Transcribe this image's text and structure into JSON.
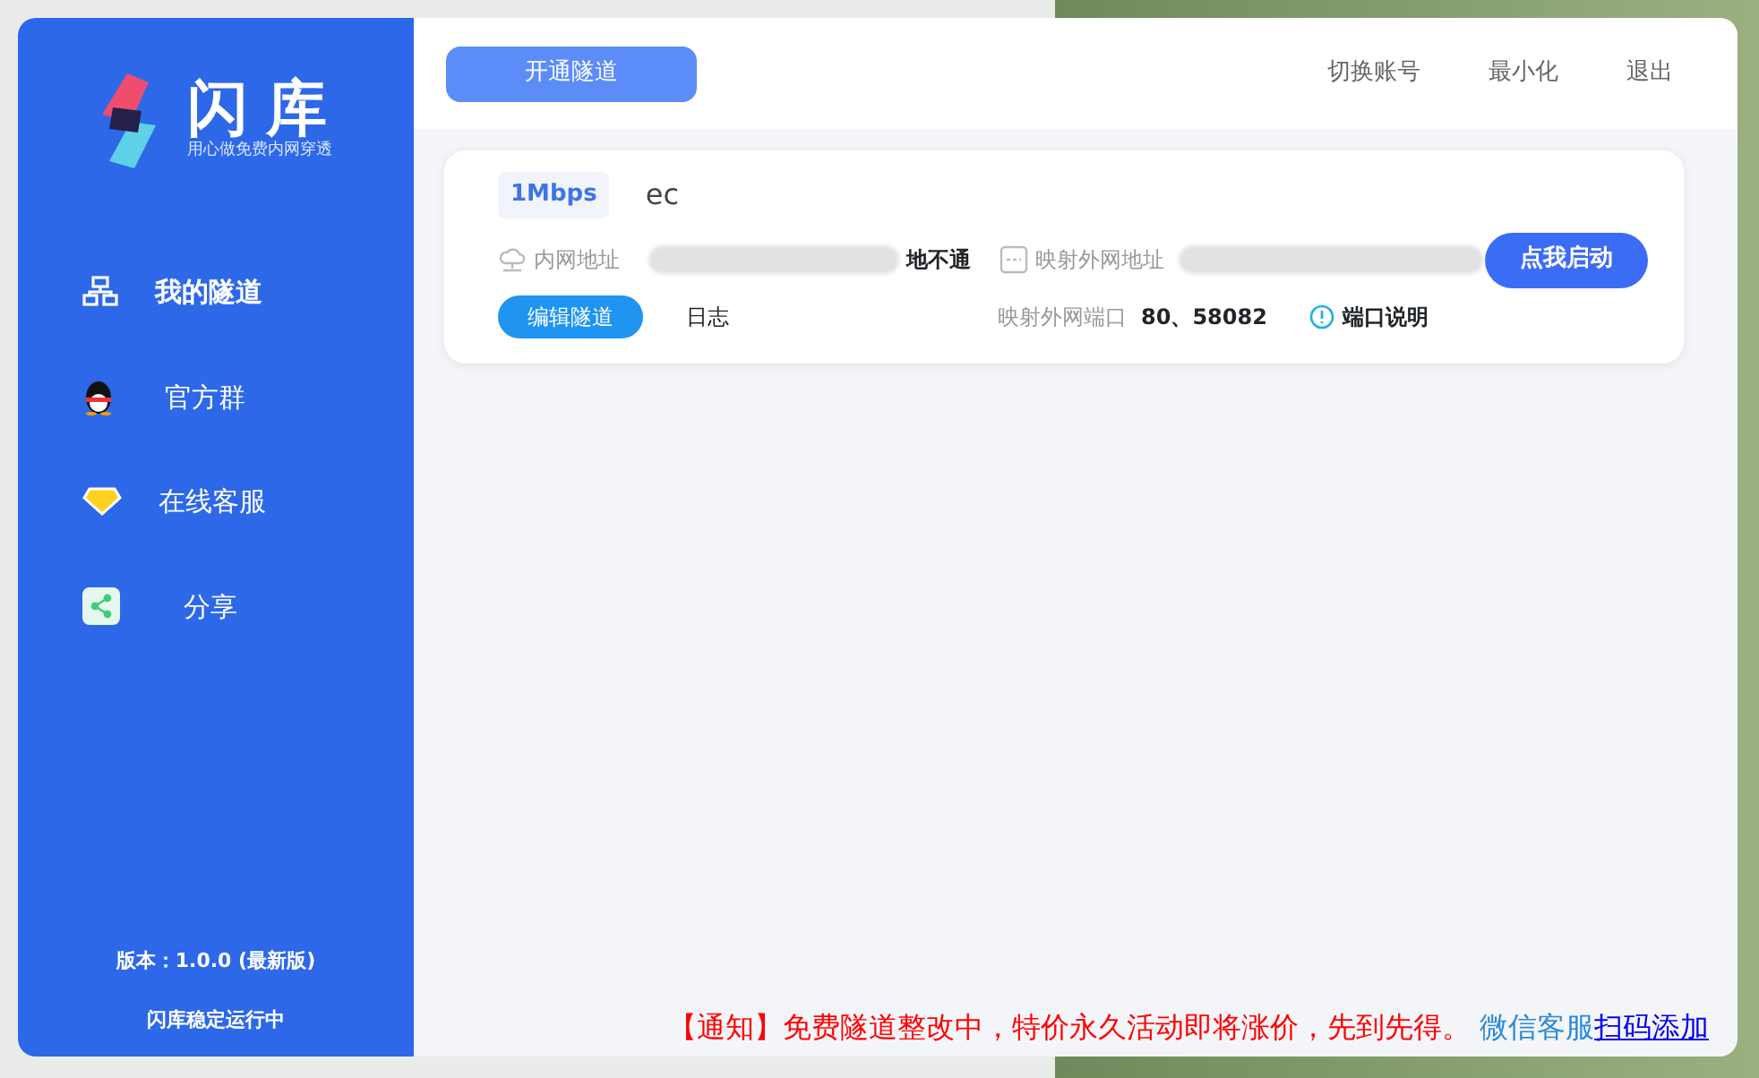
{
  "brand": {
    "name": "闪库",
    "slogan": "用心做免费内网穿透"
  },
  "sidebar": {
    "items": [
      {
        "kind": "tunnel",
        "label": "我的隧道",
        "selected": true
      },
      {
        "kind": "qq",
        "label": "官方群",
        "selected": false
      },
      {
        "kind": "gem",
        "label": "在线客服",
        "selected": false
      },
      {
        "kind": "share",
        "label": "分享",
        "selected": false
      }
    ],
    "version": "版本：1.0.0 (最新版)",
    "status": "闪库稳定运行中"
  },
  "toolbar": {
    "open_button": "开通隧道",
    "actions": [
      "切换账号",
      "最小化",
      "退出"
    ]
  },
  "tunnels": [
    {
      "speed": "1Mbps",
      "name": "ec",
      "local_label": "内网地址",
      "local_state": "地不通",
      "remote_label": "映射外网地址",
      "port_label": "映射外网端口",
      "ports": "80、58082",
      "port_help": "端口说明",
      "start_button": "点我启动",
      "edit_button": "编辑隧道",
      "log_link": "日志"
    }
  ],
  "notice": {
    "text": "【通知】免费隧道整改中，特价永久活动即将涨价，先到先得。",
    "service": "微信客服",
    "link": "扫码添加"
  }
}
